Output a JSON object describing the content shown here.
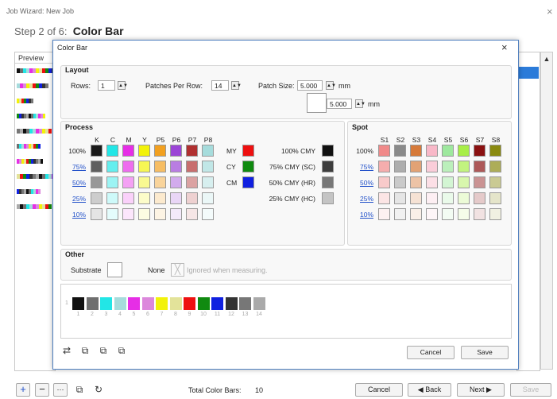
{
  "window": {
    "title": "Job Wizard: New Job",
    "close": "×"
  },
  "step": {
    "prefix": "Step 2 of 6:",
    "title": "Color Bar"
  },
  "preview": {
    "header": "Preview"
  },
  "dialog": {
    "title": "Color Bar",
    "close": "×",
    "layout": {
      "label": "Layout",
      "rows_label": "Rows:",
      "rows_value": "1",
      "ppr_label": "Patches Per Row:",
      "ppr_value": "14",
      "patch_size_label": "Patch Size:",
      "patch_w": "5.000",
      "patch_h": "5.000",
      "unit": "mm"
    },
    "process": {
      "label": "Process",
      "columns": [
        "K",
        "C",
        "M",
        "Y",
        "P5",
        "P6",
        "P7",
        "P8"
      ],
      "rows": [
        "100%",
        "75%",
        "50%",
        "25%",
        "10%"
      ],
      "overprints": [
        "MY",
        "CY",
        "CM"
      ],
      "cmy": [
        "100% CMY",
        "75% CMY (SC)",
        "50% CMY (HR)",
        "25% CMY (HC)"
      ]
    },
    "spot": {
      "label": "Spot",
      "columns": [
        "S1",
        "S2",
        "S3",
        "S4",
        "S5",
        "S6",
        "S7",
        "S8"
      ],
      "rows": [
        "100%",
        "75%",
        "50%",
        "25%",
        "10%"
      ]
    },
    "other": {
      "label": "Other",
      "substrate_label": "Substrate",
      "none_label": "None",
      "ignored_label": "Ignored when measuring."
    },
    "strip": {
      "numbers": [
        "1",
        "2",
        "3",
        "4",
        "5",
        "6",
        "7",
        "8",
        "9",
        "10",
        "11",
        "12",
        "13",
        "14"
      ],
      "row_label": "1"
    },
    "cancel": "Cancel",
    "save": "Save"
  },
  "footer": {
    "total_label": "Total Color Bars:",
    "total_value": "10",
    "cancel": "Cancel",
    "back": "◀ Back",
    "next": "Next ▶",
    "save": "Save"
  },
  "colors": {
    "process_100": [
      "#1a1a1a",
      "#22e6e6",
      "#e62ee6",
      "#f2f20a",
      "#f2a020",
      "#9b45d6",
      "#b03030",
      "#a6dcdc"
    ],
    "spot_100": [
      "#f08a8a",
      "#8a8a8a",
      "#d67a3a",
      "#f8b8c8",
      "#9ee89e",
      "#a8ee48",
      "#8a1010",
      "#8a8a10"
    ],
    "strip": [
      "#111111",
      "#6f6f6f",
      "#22e6e6",
      "#a6dcdc",
      "#e62ee6",
      "#dc88dc",
      "#f2f20a",
      "#e3e39a",
      "#ee1010",
      "#108a10",
      "#1020e0",
      "#333333",
      "#777777",
      "#aaaaaa"
    ],
    "overprint": [
      "#ee1010",
      "#108a10",
      "#1020e0"
    ],
    "cmy": [
      "#111111",
      "#3d3d3d",
      "#777777",
      "#c4c4c4"
    ]
  }
}
